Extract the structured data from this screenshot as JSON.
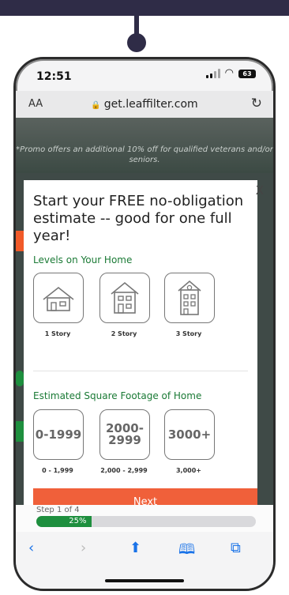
{
  "status": {
    "time": "12:51",
    "battery": "63"
  },
  "browser": {
    "text_size": "AA",
    "url": "get.leaffilter.com"
  },
  "page": {
    "promo": "*Promo offers an additional 10% off for qualified veterans and/or seniors."
  },
  "modal": {
    "close": "X",
    "headline": "Start your FREE no-obligation estimate -- good for one full year!",
    "levels_label": "Levels on Your Home",
    "levels": [
      {
        "caption": "1 Story",
        "icon": "house-1-story-icon"
      },
      {
        "caption": "2 Story",
        "icon": "house-2-story-icon"
      },
      {
        "caption": "3 Story",
        "icon": "house-3-story-icon"
      }
    ],
    "sqft_label": "Estimated Square Footage of Home",
    "sqft": [
      {
        "label": "0-1999",
        "caption": "0 - 1,999"
      },
      {
        "label": "2000-\n2999",
        "caption": "2,000 - 2,999"
      },
      {
        "label": "3000+",
        "caption": "3,000+"
      }
    ],
    "next_label": "Next",
    "step_text": "Step 1 of 4",
    "progress": {
      "label": "25%",
      "value": 25
    }
  },
  "colors": {
    "accent": "#f0603a",
    "green": "#1e8f3e",
    "frame": "#2f2c47"
  },
  "toolbar": {
    "icons": [
      "back-icon",
      "forward-icon",
      "share-icon",
      "bookmarks-icon",
      "tabs-icon"
    ]
  }
}
